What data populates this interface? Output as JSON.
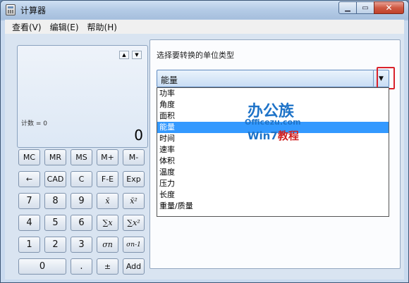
{
  "window": {
    "title": "计算器"
  },
  "menu": [
    "查看(V)",
    "编辑(E)",
    "帮助(H)"
  ],
  "display": {
    "memory": "计数 = 0",
    "value": "0"
  },
  "keys": [
    [
      "MC",
      "MR",
      "MS",
      "M+",
      "M-"
    ],
    [
      "←",
      "CAD",
      "C",
      "F-E",
      "Exp"
    ],
    [
      "7",
      "8",
      "9",
      "x̄",
      "x̄²"
    ],
    [
      "4",
      "5",
      "6",
      "∑x",
      "∑x²"
    ],
    [
      "1",
      "2",
      "3",
      "σn",
      "σn-1"
    ],
    [
      "0",
      ".",
      "±",
      "Add"
    ]
  ],
  "converter": {
    "label": "选择要转换的单位类型",
    "selected": "能量",
    "options": [
      "功率",
      "角度",
      "面积",
      "能量",
      "时间",
      "速率",
      "体积",
      "温度",
      "压力",
      "长度",
      "重量/质量"
    ],
    "selected_index": 3
  },
  "watermark": {
    "line1": "办公族",
    "line2": "Officezu.com",
    "line3a": "Win7",
    "line3b": "教程"
  }
}
